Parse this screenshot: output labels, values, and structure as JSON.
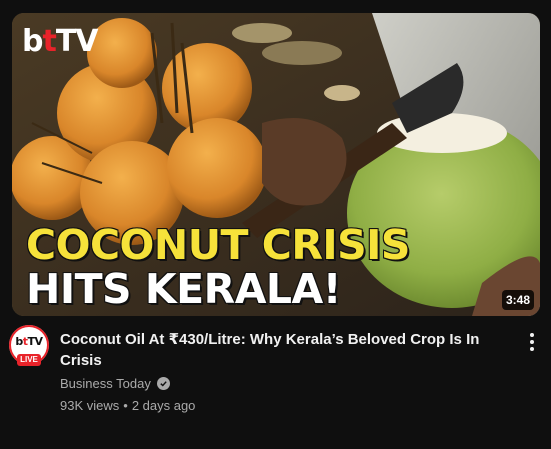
{
  "video": {
    "thumbnail": {
      "logo": {
        "b": "b",
        "t": "t",
        "tv": "TV"
      },
      "headline_line1": "COCONUT CRISIS",
      "headline_line2": "HITS KERALA!",
      "duration": "3:48"
    },
    "title": "Coconut Oil At ₹430/Litre: Why Kerala’s Beloved Crop Is In Crisis",
    "channel": {
      "name": "Business Today",
      "verified_icon": "check-circle-icon",
      "avatar_logo": {
        "b": "b",
        "t": "t",
        "tv": "TV"
      },
      "live_badge": "LIVE"
    },
    "views": "93K views",
    "separator": "•",
    "age": "2 days ago",
    "menu_icon": "more-vertical-icon"
  },
  "colors": {
    "background": "#0f0f0f",
    "brand_red": "#e8232a",
    "headline_yellow": "#f6e23a",
    "secondary_text": "#aaaaaa"
  }
}
